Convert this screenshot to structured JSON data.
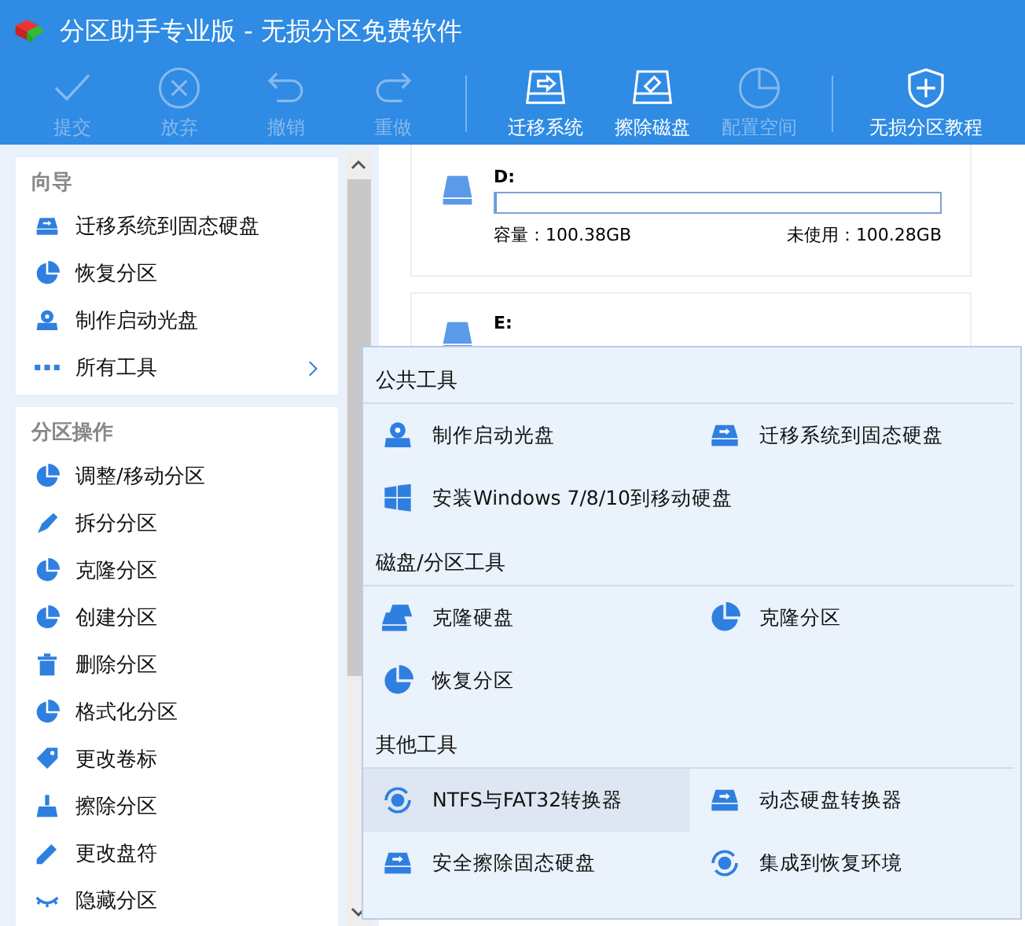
{
  "window": {
    "title": "分区助手专业版 - 无损分区免费软件"
  },
  "toolbar": [
    {
      "label": "提交",
      "disabled": true
    },
    {
      "label": "放弃",
      "disabled": true
    },
    {
      "label": "撤销",
      "disabled": true
    },
    {
      "label": "重做",
      "disabled": true
    },
    {
      "label": "迁移系统",
      "disabled": false
    },
    {
      "label": "擦除磁盘",
      "disabled": false
    },
    {
      "label": "配置空间",
      "disabled": true
    },
    {
      "label": "无损分区教程",
      "disabled": false
    }
  ],
  "sidebar": {
    "sections": [
      {
        "title": "向导",
        "items": [
          {
            "label": "迁移系统到固态硬盘",
            "kind": "action"
          },
          {
            "label": "恢复分区",
            "kind": "action"
          },
          {
            "label": "制作启动光盘",
            "kind": "action"
          },
          {
            "label": "所有工具",
            "kind": "submenu"
          }
        ]
      },
      {
        "title": "分区操作",
        "items": [
          {
            "label": "调整/移动分区",
            "kind": "action"
          },
          {
            "label": "拆分分区",
            "kind": "action"
          },
          {
            "label": "克隆分区",
            "kind": "action"
          },
          {
            "label": "创建分区",
            "kind": "action"
          },
          {
            "label": "删除分区",
            "kind": "action"
          },
          {
            "label": "格式化分区",
            "kind": "action"
          },
          {
            "label": "更改卷标",
            "kind": "action"
          },
          {
            "label": "擦除分区",
            "kind": "action"
          },
          {
            "label": "更改盘符",
            "kind": "action"
          },
          {
            "label": "隐藏分区",
            "kind": "action"
          }
        ]
      }
    ]
  },
  "disks": [
    {
      "name": "D:",
      "level": 0.002,
      "capacity": "容量：100.38GB",
      "free": "未使用：100.28GB"
    },
    {
      "name": "E:"
    }
  ],
  "tools_menu": {
    "sections": [
      {
        "title": "公共工具",
        "items": [
          {
            "label": "制作启动光盘",
            "selected": false
          },
          {
            "label": "迁移系统到固态硬盘",
            "selected": false
          },
          {
            "label": "安装Windows 7/8/10到移动硬盘",
            "selected": false
          }
        ]
      },
      {
        "title": "磁盘/分区工具",
        "items": [
          {
            "label": "克隆硬盘",
            "selected": false
          },
          {
            "label": "克隆分区",
            "selected": false
          },
          {
            "label": "恢复分区",
            "selected": false
          }
        ]
      },
      {
        "title": "其他工具",
        "items": [
          {
            "label": "NTFS与FAT32转换器",
            "selected": true
          },
          {
            "label": "动态硬盘转换器",
            "selected": false
          },
          {
            "label": "安全擦除固态硬盘",
            "selected": false
          },
          {
            "label": "集成到恢复环境",
            "selected": false
          }
        ]
      }
    ]
  }
}
